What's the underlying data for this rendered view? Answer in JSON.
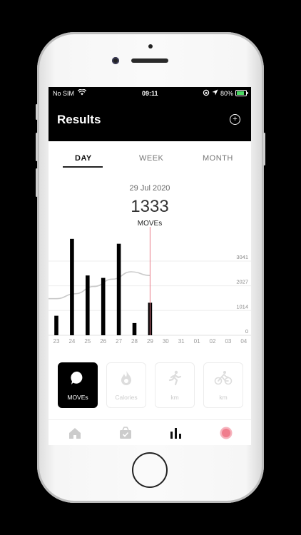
{
  "status": {
    "carrier": "No SIM",
    "time": "09:11",
    "battery": "80%"
  },
  "header": {
    "title": "Results"
  },
  "tabs": [
    {
      "label": "DAY",
      "active": true
    },
    {
      "label": "WEEK",
      "active": false
    },
    {
      "label": "MONTH",
      "active": false
    }
  ],
  "summary": {
    "date": "29 Jul 2020",
    "value": "1333",
    "unit": "MOVEs"
  },
  "chart_data": {
    "type": "bar",
    "categories": [
      "23",
      "24",
      "25",
      "26",
      "27",
      "28",
      "29",
      "30",
      "31",
      "01",
      "02",
      "03",
      "04"
    ],
    "values": [
      800,
      3950,
      2450,
      2350,
      3750,
      500,
      1333,
      0,
      0,
      0,
      0,
      0,
      0
    ],
    "y_ticks": [
      "3041",
      "2027",
      "1014",
      "0"
    ],
    "ylim": [
      0,
      4150
    ],
    "selected_category": "29",
    "trend_values": [
      1500,
      1700,
      2000,
      2300,
      2600,
      2450
    ],
    "colors": {
      "bar": "#000000",
      "trend": "#c9c9c9",
      "marker": "#e87a89",
      "grid": "#eeeeee"
    }
  },
  "cards": [
    {
      "label": "MOVEs",
      "icon": "moves-bubble-icon",
      "active": true
    },
    {
      "label": "Calories",
      "icon": "flame-icon",
      "active": false
    },
    {
      "label": "km",
      "icon": "runner-icon",
      "active": false
    },
    {
      "label": "km",
      "icon": "bicycle-icon",
      "active": false
    }
  ],
  "tabbar": [
    {
      "icon": "home-icon"
    },
    {
      "icon": "basket-icon"
    },
    {
      "icon": "bar-chart-icon"
    },
    {
      "icon": "record-icon"
    }
  ]
}
